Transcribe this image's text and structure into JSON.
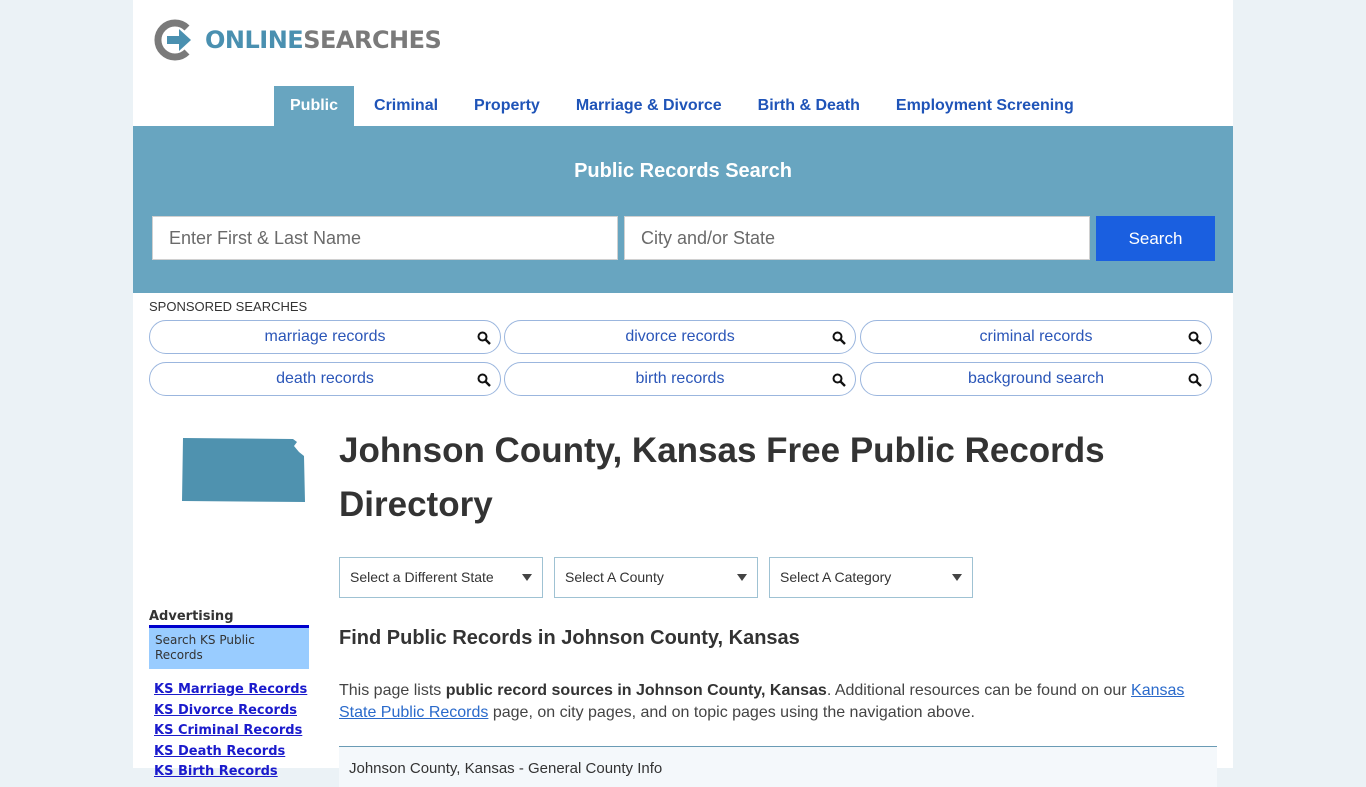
{
  "logo": {
    "part1": "ONLINE",
    "part2": "SEARCHES"
  },
  "nav": {
    "items": [
      {
        "label": "Public",
        "active": true
      },
      {
        "label": "Criminal",
        "active": false
      },
      {
        "label": "Property",
        "active": false
      },
      {
        "label": "Marriage & Divorce",
        "active": false
      },
      {
        "label": "Birth & Death",
        "active": false
      },
      {
        "label": "Employment Screening",
        "active": false
      }
    ]
  },
  "search": {
    "title": "Public Records Search",
    "name_placeholder": "Enter First & Last Name",
    "city_placeholder": "City and/or State",
    "button_label": "Search"
  },
  "sponsored": {
    "label": "SPONSORED SEARCHES",
    "items": [
      "marriage records",
      "divorce records",
      "criminal records",
      "death records",
      "birth records",
      "background search"
    ]
  },
  "main": {
    "title": "Johnson County, Kansas Free Public Records Directory",
    "selects": [
      "Select a Different State",
      "Select A County",
      "Select A Category"
    ],
    "find_heading": "Find Public Records in Johnson County, Kansas",
    "para": {
      "pre": "This page lists ",
      "bold": "public record sources in Johnson County, Kansas",
      "mid": ". Additional resources can be found on our ",
      "link": "Kansas State Public Records",
      "post": " page, on city pages, and on topic pages using the navigation above."
    },
    "info_box_title": "Johnson County, Kansas - General County Info"
  },
  "sidebar": {
    "advertising": "Advertising",
    "ad_box": "Search KS Public Records",
    "links": [
      "KS Marriage Records",
      "KS Divorce Records",
      "KS Criminal Records",
      "KS Death Records",
      "KS Birth Records"
    ]
  },
  "colors": {
    "accent": "#68a5c0",
    "button": "#1a5fe0",
    "link": "#1f54b8"
  }
}
